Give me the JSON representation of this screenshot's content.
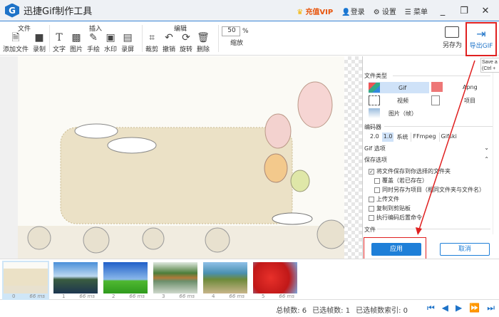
{
  "app": {
    "title": "迅捷Gif制作工具",
    "logo_letter": "G"
  },
  "titlebar": {
    "vip": "充值VIP",
    "login": "登录",
    "settings": "设置",
    "menu": "菜单"
  },
  "ribbon": {
    "groups": [
      {
        "title": "文件",
        "tools": [
          "添加文件",
          "录制"
        ]
      },
      {
        "title": "插入",
        "tools": [
          "文字",
          "图片",
          "手绘",
          "水印",
          "录屏"
        ]
      },
      {
        "title": "编辑",
        "tools": [
          "裁剪",
          "撤销",
          "旋转",
          "删除"
        ]
      }
    ],
    "zoom": {
      "value": "50",
      "unit": "%",
      "label": "缩放"
    },
    "save_as": "另存为",
    "export": "导出GIF"
  },
  "tooltip": {
    "line1": "Save a",
    "line2": "(Ctrl +"
  },
  "panel": {
    "file_type": "文件类型",
    "types": [
      "Gif",
      "Apng",
      "视频",
      "项目",
      "图片（帧）"
    ],
    "encoder": "编码器",
    "encoders": [
      "2.0",
      "1.0",
      "系统",
      "FFmpeg",
      "Gifski"
    ],
    "gif_options": "Gif 选项",
    "save_options": "保存选项",
    "checks": [
      {
        "label": "将文件保存到你选择的文件夹",
        "checked": true
      },
      {
        "label": "覆盖（若已存在）",
        "checked": false
      },
      {
        "label": "同时另存为项目（相同文件夹与文件名）",
        "checked": false
      },
      {
        "label": "上传文件",
        "checked": false
      },
      {
        "label": "复制到剪贴板",
        "checked": false
      },
      {
        "label": "执行编码后置命令",
        "checked": false
      }
    ],
    "file_section": "文件",
    "apply": "应用",
    "cancel": "取消"
  },
  "frames": [
    {
      "index": "0",
      "delay": "66 ms"
    },
    {
      "index": "1",
      "delay": "66 ms"
    },
    {
      "index": "2",
      "delay": "66 ms"
    },
    {
      "index": "3",
      "delay": "66 ms"
    },
    {
      "index": "4",
      "delay": "66 ms"
    },
    {
      "index": "5",
      "delay": "66 ms"
    }
  ],
  "status": {
    "total": "总帧数: 6",
    "selected": "已选帧数: 1",
    "index": "已选帧数索引: 0"
  },
  "colors": {
    "accent": "#1e7fd8",
    "highlight": "#e02020",
    "vip": "#e8550c"
  }
}
